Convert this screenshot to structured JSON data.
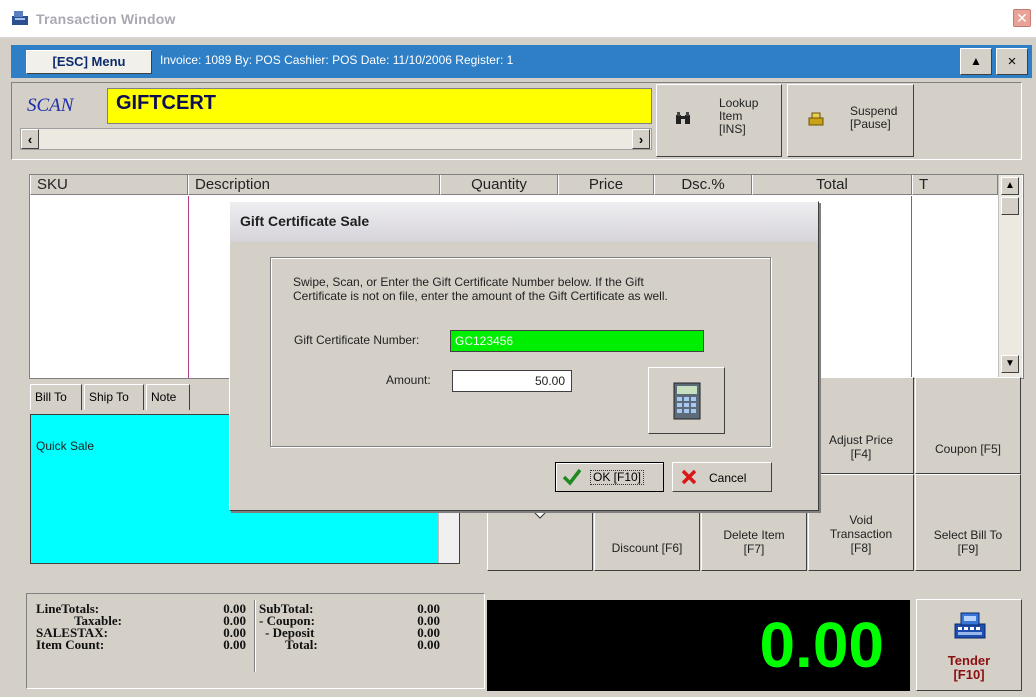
{
  "window": {
    "title": "Transaction Window"
  },
  "infobar": {
    "menu_label": "[ESC] Menu",
    "info": "Invoice: 1089  By: POS  Cashier: POS   Date: 11/10/2006  Register: 1",
    "up_glyph": "▲",
    "close_glyph": "×"
  },
  "scan": {
    "label": "SCAN",
    "value": "GIFTCERT"
  },
  "buttons": {
    "lookup": {
      "line1": "Lookup",
      "line2": "Item",
      "line3": "[INS]"
    },
    "suspend": {
      "line1": "Suspend",
      "line2": "[Pause]"
    },
    "adjust_price": {
      "line1": "Adjust Price",
      "line2": "[F4]"
    },
    "coupon": {
      "line1": "Coupon [F5]"
    },
    "discount": {
      "line1": "Discount [F6]"
    },
    "delete_item": {
      "line1": "Delete Item",
      "line2": "[F7]"
    },
    "void": {
      "line1": "Void",
      "line2": "Transaction",
      "line3": "[F8]"
    },
    "select_bill_to": {
      "line1": "Select Bill To",
      "line2": "[F9]"
    },
    "tender": {
      "line1": "Tender",
      "line2": "[F10]"
    }
  },
  "grid": {
    "columns": [
      "SKU",
      "Description",
      "Quantity",
      "Price",
      "Dsc.%",
      "Total",
      "T"
    ]
  },
  "tabs": [
    "Bill To",
    "Ship To",
    "Note"
  ],
  "bill_to": {
    "text": "Quick Sale"
  },
  "totals": {
    "left_labels": [
      "LineTotals:",
      "Taxable:",
      "SALESTAX:",
      "Item Count:"
    ],
    "left_values": [
      "0.00",
      "0.00",
      "0.00",
      "0.00"
    ],
    "right_labels": [
      "SubTotal:",
      "- Coupon:",
      "- Deposit",
      "Total:"
    ],
    "right_values": [
      "0.00",
      "0.00",
      "0.00",
      "0.00"
    ]
  },
  "display": {
    "amount": "0.00"
  },
  "dialog": {
    "title": "Gift Certificate Sale",
    "message_line1": "Swipe, Scan, or Enter the Gift Certificate Number below.  If the Gift",
    "message_line2": "Certificate is not on file, enter the amount of the Gift Certificate as well.",
    "gc_label": "Gift Certificate Number:",
    "gc_value": "GC123456",
    "amount_label": "Amount:",
    "amount_value": "50.00",
    "ok_label": "OK [F10]",
    "cancel_label": "Cancel"
  },
  "colors": {
    "scan_bg": "#ffff00",
    "bill_bg": "#00ffff",
    "gc_bg": "#00ee00",
    "lcd_fg": "#00ff00",
    "infobar": "#2e7fc6"
  }
}
